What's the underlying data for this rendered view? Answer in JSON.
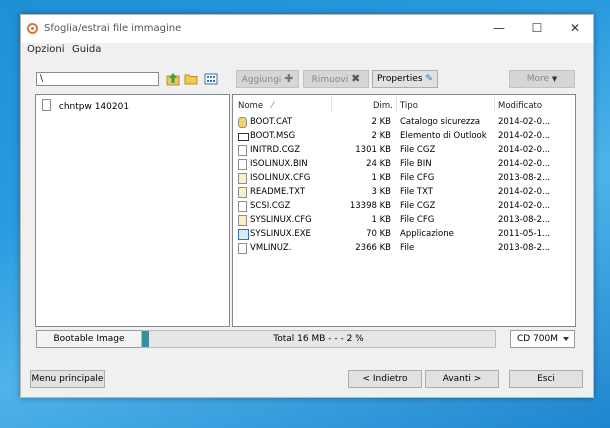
{
  "window": {
    "title": "Sfoglia/estrai file immagine"
  },
  "menu": [
    "Opzioni",
    "Guida"
  ],
  "toolbar": {
    "path_value": "\\",
    "add_label": "Aggiungi",
    "remove_label": "Rimuovi",
    "properties_label": "Properties",
    "more_label": "More"
  },
  "tree": {
    "root": "chntpw 140201"
  },
  "columns": {
    "name": "Nome",
    "size": "Dim.",
    "type": "Tipo",
    "modified": "Modificato"
  },
  "files": [
    {
      "name": "BOOT.CAT",
      "size": "2 KB",
      "type": "Catalogo sicurezza",
      "modified": "2014-02-0...",
      "icon": "catalog-icon"
    },
    {
      "name": "BOOT.MSG",
      "size": "2 KB",
      "type": "Elemento di Outlook",
      "modified": "2014-02-0...",
      "icon": "mail-icon"
    },
    {
      "name": "INITRD.CGZ",
      "size": "1301 KB",
      "type": "File CGZ",
      "modified": "2014-02-0...",
      "icon": "file-icon"
    },
    {
      "name": "ISOLINUX.BIN",
      "size": "24 KB",
      "type": "File BIN",
      "modified": "2014-02-0...",
      "icon": "file-icon"
    },
    {
      "name": "ISOLINUX.CFG",
      "size": "1 KB",
      "type": "File CFG",
      "modified": "2013-08-2...",
      "icon": "config-file-icon"
    },
    {
      "name": "README.TXT",
      "size": "3 KB",
      "type": "File TXT",
      "modified": "2014-02-0...",
      "icon": "text-file-icon"
    },
    {
      "name": "SCSI.CGZ",
      "size": "13398 KB",
      "type": "File CGZ",
      "modified": "2014-02-0...",
      "icon": "file-icon"
    },
    {
      "name": "SYSLINUX.CFG",
      "size": "1 KB",
      "type": "File CFG",
      "modified": "2013-08-2...",
      "icon": "config-file-icon"
    },
    {
      "name": "SYSLINUX.EXE",
      "size": "70 KB",
      "type": "Applicazione",
      "modified": "2011-05-1...",
      "icon": "exe-icon"
    },
    {
      "name": "VMLINUZ.",
      "size": "2366 KB",
      "type": "File",
      "modified": "2013-08-2...",
      "icon": "file-icon"
    }
  ],
  "status": {
    "label": "Bootable Image",
    "progress_text": "Total  16 MB  - - -  2 %",
    "progress_percent": 2,
    "media": "CD 700M"
  },
  "footer": {
    "main_menu": "Menu principale",
    "back": "< Indietro",
    "next": "Avanti >",
    "exit": "Esci"
  },
  "colors": {
    "accent": "#e0762a",
    "progress": "#3a8f9c"
  }
}
